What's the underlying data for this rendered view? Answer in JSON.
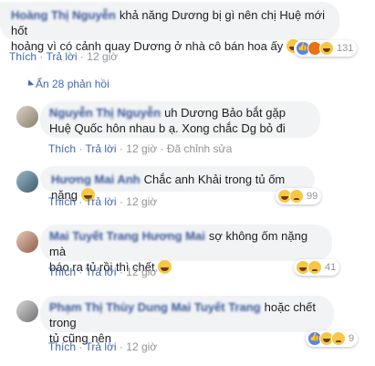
{
  "top_comment": {
    "author": "Hoàng Thị Nguyễn",
    "text_line1": "khả năng Dương bị gì nên chị Huệ mới hốt",
    "text_line2": "hoảng vì có cảnh quay Dương ở nhà cô bán hoa ấy",
    "like": "Thích",
    "reply": "Trả lời",
    "time": "12 giờ",
    "reaction_count": "131"
  },
  "hide_replies": "Ẩn 28 phản hồi",
  "replies": [
    {
      "author": "Nguyễn Thị Nguyễn",
      "text_line1": "uh Dương Bảo bắt gặp",
      "text_line2": "Huệ Quốc hôn nhau b ạ. Xong chắc Dg bỏ đi",
      "like": "Thích",
      "reply": "Trả lời",
      "time": "12 giờ",
      "edited": "Đã chỉnh sửa",
      "reaction_count": ""
    },
    {
      "author": "Hương Mai Anh",
      "text_line1": "Chắc anh Khải trong tủ ốm nặng",
      "text_line2": "",
      "like": "Thích",
      "reply": "Trả lời",
      "time": "12 giờ",
      "reaction_count": "99"
    },
    {
      "author": "Mai Tuyết Trang Hương Mai",
      "text_line1": "sợ không ốm nặng mà",
      "text_line2": "báo ra tủ rồi thì chết",
      "like": "Thích",
      "reply": "Trả lời",
      "time": "12 giờ",
      "reaction_count": "41"
    },
    {
      "author": "Phạm Thị Thùy Dung Mai Tuyết Trang",
      "text_line1": "hoặc chết trong",
      "text_line2": "tủ cũng nên",
      "like": "Thích",
      "reply": "Trả lời",
      "time": "12 giờ",
      "reaction_count": "9"
    }
  ],
  "separator": "·",
  "colors": {
    "link": "#4267b2",
    "bubble": "#f2f3f5",
    "meta": "#90949c"
  }
}
